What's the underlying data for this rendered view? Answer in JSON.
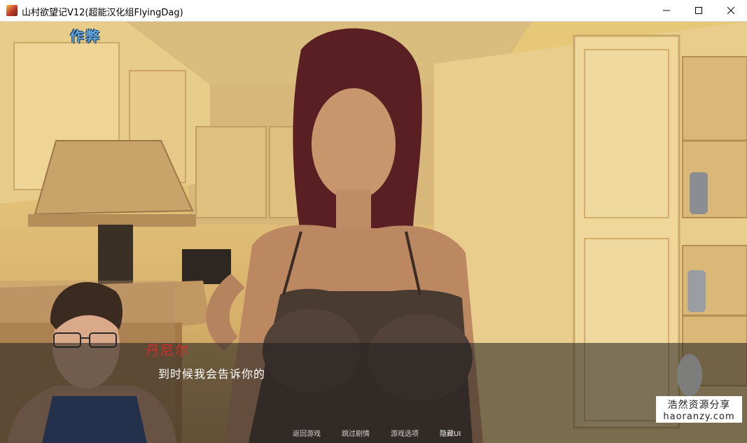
{
  "window": {
    "title": "山村欲望记V12(超能汉化组FlyingDag)",
    "controls": {
      "minimize_icon": "minimize-icon",
      "maximize_icon": "maximize-icon",
      "close_icon": "close-icon"
    }
  },
  "game": {
    "cheat_label": "作弊",
    "dialogue": {
      "speaker": "丹尼尔",
      "text": "到时候我会告诉你的"
    },
    "quick_menu": [
      {
        "label": "返回游戏"
      },
      {
        "label": "跳过剧情"
      },
      {
        "label": "游戏选项"
      },
      {
        "label": "隐藏UI"
      }
    ]
  },
  "watermark": {
    "line1": "浩然资源分享",
    "line2": "haoranzy.com"
  },
  "colors": {
    "speaker": "#d42b2b",
    "cheat": "#5fa3d8",
    "dialogue_bg": "rgba(30,30,30,0.55)"
  }
}
